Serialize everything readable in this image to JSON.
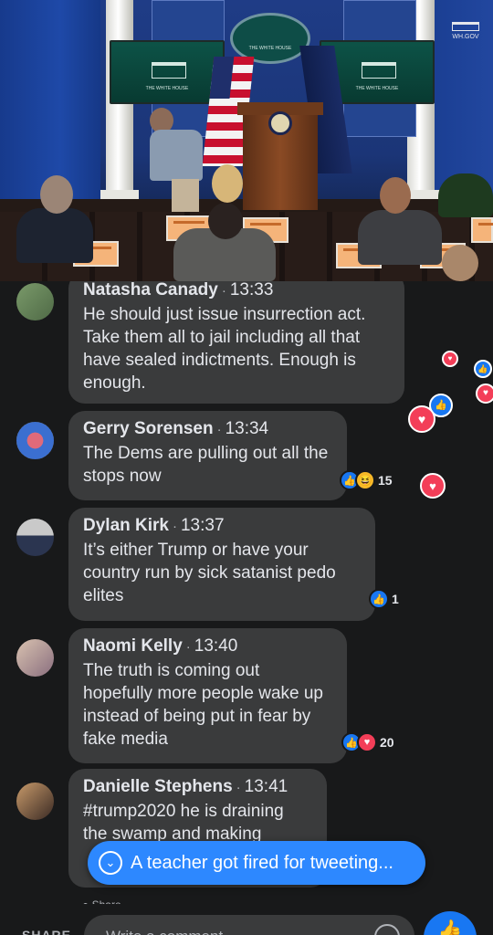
{
  "video": {
    "oval_text": "THE WHITE HOUSE",
    "screen_text": "THE WHITE HOUSE",
    "wh_gov": "WH.GOV"
  },
  "comments": [
    {
      "name": "Natasha Canady",
      "time": "13:33",
      "text": "He should just issue insurrection act. Take them all to jail including all that have sealed indictments. Enough is enough.",
      "reactions": [],
      "count": ""
    },
    {
      "name": "Gerry Sorensen",
      "time": "13:34",
      "text": "The Dems are pulling out all the stops now",
      "reactions": [
        "like",
        "haha"
      ],
      "count": "15"
    },
    {
      "name": "Dylan Kirk",
      "time": "13:37",
      "text": "It’s either Trump or have your country run by sick satanist pedo elites",
      "reactions": [
        "like"
      ],
      "count": "1"
    },
    {
      "name": "Naomi Kelly",
      "time": "13:40",
      "text": "The truth is coming out hopefully more people wake up instead of being put in fear by fake media",
      "reactions": [
        "like",
        "heart"
      ],
      "count": "20"
    },
    {
      "name": "Danielle Stephens",
      "time": "13:41",
      "text": "#trump2020 he is draining the swamp and making",
      "reactions": [],
      "count": ""
    }
  ],
  "new_comment_pill": {
    "label": "A teacher got fired for tweeting...",
    "icon": "chevron-down-icon"
  },
  "composer": {
    "share_label": "SHARE",
    "placeholder": "Write a comment...",
    "partial_label": "Share"
  },
  "colors": {
    "accent": "#2d88ff",
    "bubble": "#3a3b3c",
    "background": "#18191a",
    "heart": "#f33e58",
    "like": "#1877f2"
  }
}
